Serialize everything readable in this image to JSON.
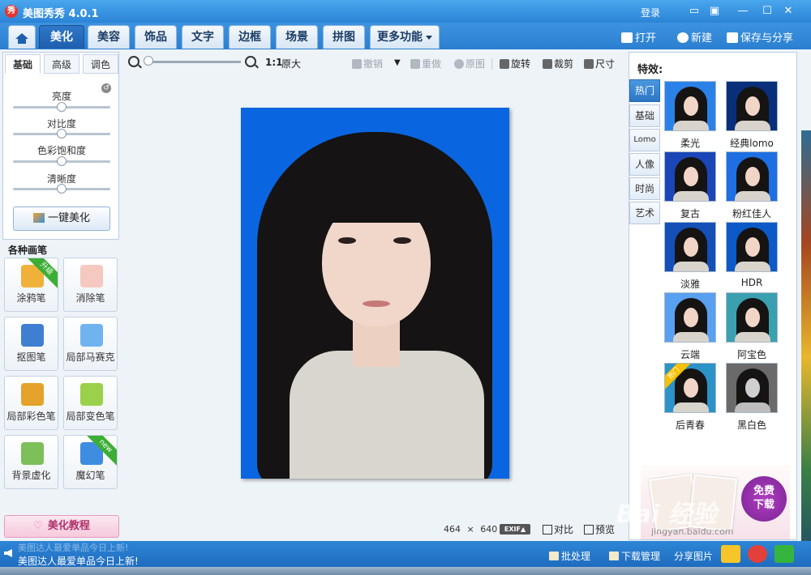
{
  "app": {
    "logo_char": "秀",
    "title": "美图秀秀 4.0.1",
    "login": "登录"
  },
  "window_controls": [
    "▭",
    "▣",
    "—",
    "☐",
    "✕"
  ],
  "main_tabs": [
    {
      "label": "美化",
      "active": true
    },
    {
      "label": "美容",
      "active": false
    },
    {
      "label": "饰品",
      "active": false
    },
    {
      "label": "文字",
      "active": false
    },
    {
      "label": "边框",
      "active": false
    },
    {
      "label": "场景",
      "active": false
    },
    {
      "label": "拼图",
      "active": false
    },
    {
      "label": "更多功能",
      "active": false
    }
  ],
  "top_actions": {
    "open": "打开",
    "new": "新建",
    "save_share": "保存与分享"
  },
  "left_panel": {
    "sub_tabs": [
      {
        "label": "基础",
        "active": true
      },
      {
        "label": "高级",
        "active": false
      },
      {
        "label": "调色",
        "active": false
      }
    ],
    "reset_icon": "↺",
    "sliders": [
      {
        "label": "亮度",
        "value": 0.5
      },
      {
        "label": "对比度",
        "value": 0.5
      },
      {
        "label": "色彩饱和度",
        "value": 0.5
      },
      {
        "label": "清晰度",
        "value": 0.5
      }
    ],
    "one_key_button": "一键美化",
    "brushes_title": "各种画笔",
    "tools": [
      {
        "label": "涂鸦笔",
        "icon": "pencil-icon",
        "badge": "升级",
        "color": "#f0b13a"
      },
      {
        "label": "消除笔",
        "icon": "eraser-icon",
        "badge": "",
        "color": "#f6c9c0"
      },
      {
        "label": "抠图笔",
        "icon": "cutout-pen-icon",
        "badge": "",
        "color": "#3f7fd2"
      },
      {
        "label": "局部马赛克",
        "icon": "mosaic-icon",
        "badge": "",
        "color": "#6fb4ef"
      },
      {
        "label": "局部彩色笔",
        "icon": "color-brush-icon",
        "badge": "",
        "color": "#e5a22a"
      },
      {
        "label": "局部变色笔",
        "icon": "recolor-icon",
        "badge": "",
        "color": "#9bd04a"
      },
      {
        "label": "背景虚化",
        "icon": "blur-icon",
        "badge": "",
        "color": "#7dbf58"
      },
      {
        "label": "魔幻笔",
        "icon": "magic-pen-icon",
        "badge": "new",
        "color": "#3f8de0"
      }
    ],
    "tutorial": "美化教程",
    "tutorial_icon": "♡"
  },
  "toolbar": {
    "zoom_level_label": "1:1",
    "original_size": "原大",
    "undo": "撤销",
    "redo": "重做",
    "original": "原图",
    "rotate": "旋转",
    "crop": "裁剪",
    "resize": "尺寸"
  },
  "canvas": {
    "width_value": "464",
    "times": "×",
    "height_value": "640",
    "exif": "EXIF▲",
    "compare": "对比",
    "preview": "预览",
    "background_color": "#0a66e0"
  },
  "effects": {
    "title": "特效:",
    "categories": [
      {
        "label": "热门",
        "active": true
      },
      {
        "label": "基础",
        "active": false
      },
      {
        "label": "Lomo",
        "active": false
      },
      {
        "label": "人像",
        "active": false
      },
      {
        "label": "时尚",
        "active": false
      },
      {
        "label": "艺术",
        "active": false
      }
    ],
    "items": [
      {
        "label": "柔光",
        "bg": "#2a82e8",
        "hot": false
      },
      {
        "label": "经典lomo",
        "bg": "#0a2f7a",
        "hot": false
      },
      {
        "label": "复古",
        "bg": "#1a46b8",
        "hot": false
      },
      {
        "label": "粉红佳人",
        "bg": "#1d6fe2",
        "hot": false
      },
      {
        "label": "淡雅",
        "bg": "#1450b8",
        "hot": false
      },
      {
        "label": "HDR",
        "bg": "#0b5ac8",
        "hot": false
      },
      {
        "label": "云端",
        "bg": "#5aa0f0",
        "hot": false
      },
      {
        "label": "阿宝色",
        "bg": "#3aa0b0",
        "hot": false
      },
      {
        "label": "后青春",
        "bg": "#2b93c8",
        "hot": true,
        "hot_label": "热门"
      },
      {
        "label": "黑白色",
        "bg": "#6a6a6a",
        "hot": false
      }
    ],
    "ad_text_line1": "免费",
    "ad_text_line2": "下载"
  },
  "watermark": {
    "brand": "Bai 经验",
    "url": "jingyan.baidu.com"
  },
  "statusbar": {
    "news_top": "美图达人最爱单品今日上新!",
    "news": "美图达人最爱单品今日上新!",
    "batch": "批处理",
    "download_manager": "下载管理",
    "share_pic": "分享图片"
  }
}
